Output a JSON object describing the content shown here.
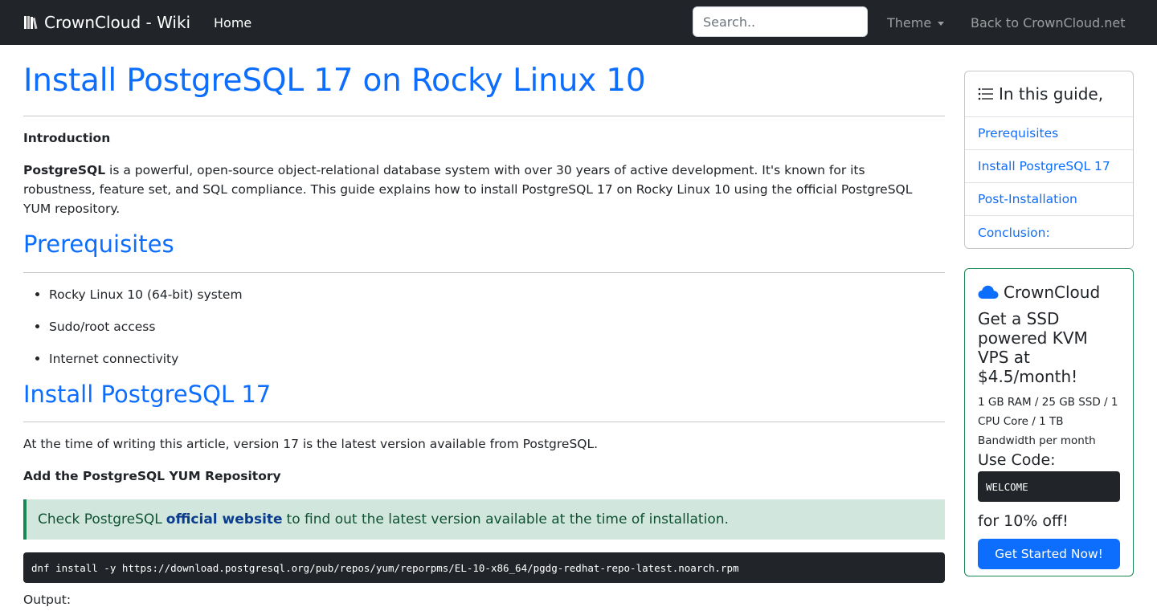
{
  "navbar": {
    "brand": "CrownCloud - Wiki",
    "brand_icon": "books-icon",
    "home_label": "Home",
    "search_placeholder": "Search..",
    "theme_label": "Theme",
    "back_label": "Back to CrownCloud.net"
  },
  "article": {
    "title": "Install PostgreSQL 17 on Rocky Linux 10",
    "intro_heading": "Introduction",
    "intro_bold": "PostgreSQL",
    "intro_text": " is a powerful, open-source object-relational database system with over 30 years of active development. It's known for its robustness, feature set, and SQL compliance. This guide explains how to install PostgreSQL 17 on Rocky Linux 10 using the official PostgreSQL YUM repository.",
    "prereq_heading": "Prerequisites",
    "prereq_items": [
      "Rocky Linux 10 (64-bit) system",
      "Sudo/root access",
      "Internet connectivity"
    ],
    "install_heading": "Install PostgreSQL 17",
    "install_text": "At the time of writing this article, version 17 is the latest version available from PostgreSQL.",
    "repo_heading": "Add the PostgreSQL YUM Repository",
    "alert_prefix": "Check PostgreSQL",
    "alert_link": "official website",
    "alert_suffix": "to find out the latest version available at the time of installation.",
    "command": "dnf install -y https://download.postgresql.org/pub/repos/yum/reporpms/EL-10-x86_64/pgdg-redhat-repo-latest.noarch.rpm",
    "output_label": "Output:"
  },
  "toc": {
    "title": "In this guide,",
    "items": [
      "Prerequisites",
      "Install PostgreSQL 17",
      "Post-Installation",
      "Conclusion:"
    ]
  },
  "promo": {
    "brand": "CrownCloud",
    "headline": "Get a SSD powered KVM VPS at $4.5/month!",
    "specs": "1 GB RAM / 25 GB SSD / 1 CPU Core / 1 TB Bandwidth per month",
    "code_label": "Use Code:",
    "code": "WELCOME",
    "discount": "for 10% off!",
    "button": "Get Started Now!"
  },
  "colors": {
    "navbar_bg": "#212529",
    "link": "#0d6efd",
    "alert_bg": "#d1e7dd",
    "alert_border": "#198754",
    "code_bg": "#212529"
  }
}
